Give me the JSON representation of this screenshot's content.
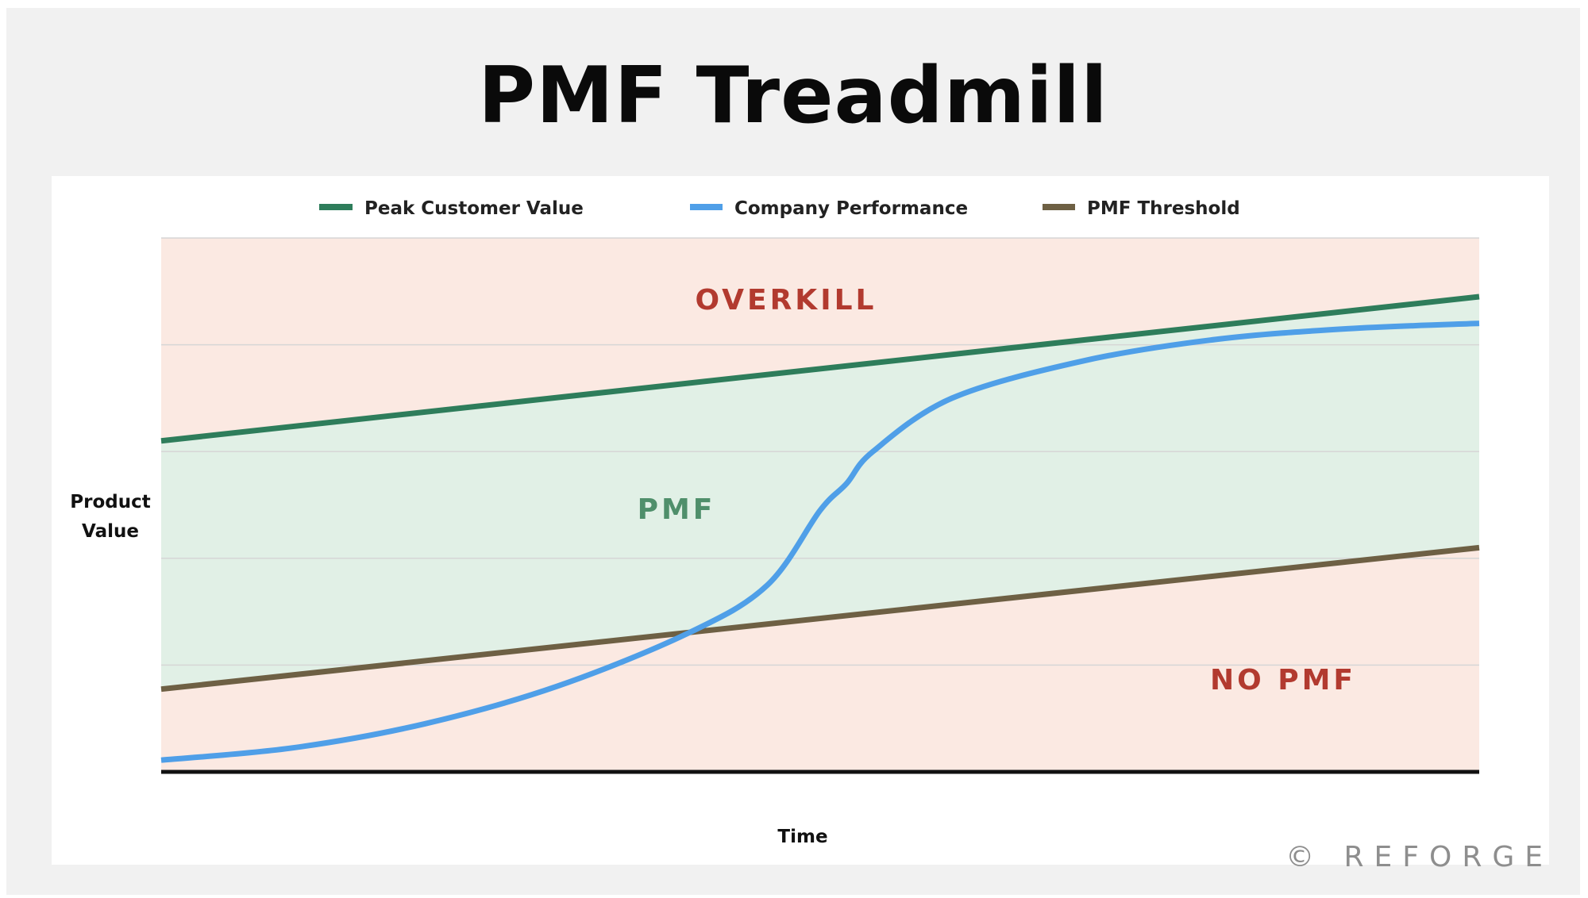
{
  "title": "PMF Treadmill",
  "watermark": "© REFORGE",
  "chart_data": {
    "type": "line",
    "title": "PMF Treadmill",
    "xlabel": "Time",
    "ylabel": "Product Value",
    "xlim": [
      0,
      100
    ],
    "ylim": [
      0,
      10
    ],
    "grid": true,
    "legend": "top",
    "series": [
      {
        "name": "Peak Customer Value",
        "color": "#2e7d5b",
        "x": [
          0,
          100
        ],
        "y": [
          6.2,
          8.9
        ]
      },
      {
        "name": "Company Performance",
        "color": "#4f9fe8",
        "x": [
          0,
          10,
          20,
          30,
          40,
          46,
          50,
          52,
          54,
          60,
          70,
          80,
          90,
          100
        ],
        "y": [
          0.22,
          0.45,
          0.9,
          1.6,
          2.6,
          3.5,
          4.9,
          5.4,
          6.0,
          7.0,
          7.7,
          8.1,
          8.3,
          8.4
        ]
      },
      {
        "name": "PMF Threshold",
        "color": "#6e6044",
        "x": [
          0,
          100
        ],
        "y": [
          1.55,
          4.2
        ]
      }
    ],
    "regions": [
      {
        "label": "OVERKILL",
        "color": "#fbe9e2",
        "label_color": "#b23a2f"
      },
      {
        "label": "PMF",
        "color": "#e1f0e6",
        "label_color": "#4f8f6b"
      },
      {
        "label": "NO PMF",
        "color": "#fbe9e2",
        "label_color": "#b23a2f"
      }
    ]
  }
}
